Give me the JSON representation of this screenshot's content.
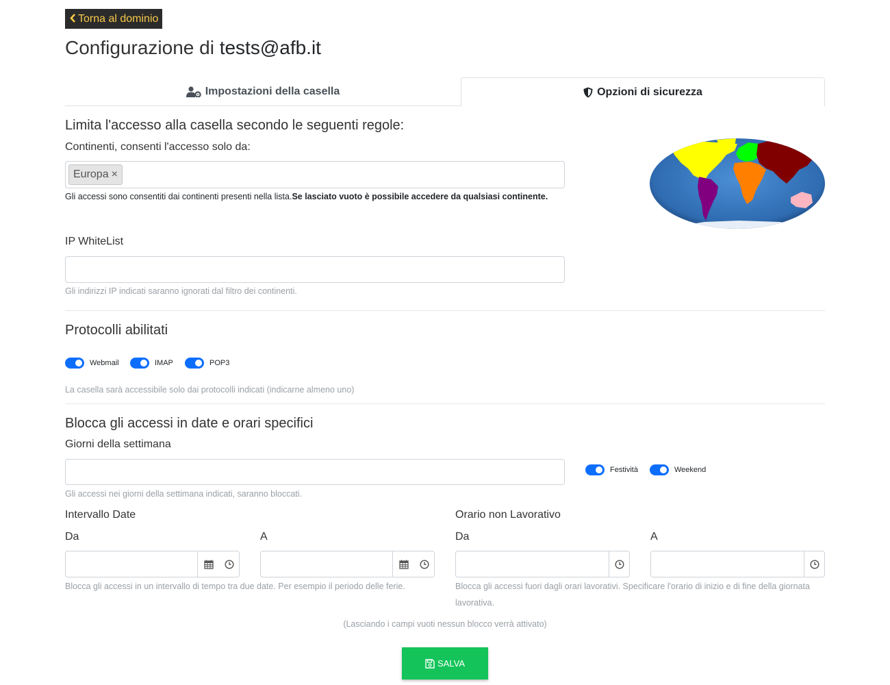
{
  "header": {
    "back_label": "Torna al dominio",
    "title_prefix": "Configurazione di ",
    "title_email": "tests@afb.it"
  },
  "tabs": [
    {
      "label": "Impostazioni della casella",
      "icon": "user-gear-icon",
      "active": false
    },
    {
      "label": "Opzioni di sicurezza",
      "icon": "shield-icon",
      "active": true
    }
  ],
  "access": {
    "heading": "Limita l'accesso alla casella secondo le seguenti regole:",
    "continents_label": "Continenti, consenti l'accesso solo da:",
    "selected_continents": [
      {
        "label": "Europa",
        "remove": "×"
      }
    ],
    "continents_help": "Gli accessi sono consentiti dai continenti presenti nella lista.",
    "continents_help_bold": "Se lasciato vuoto è possibile accedere da qualsiasi continente.",
    "map_colors": {
      "north_america": "#ffff00",
      "south_america": "#800080",
      "europe": "#00ff00",
      "africa": "#ff7f00",
      "asia": "#800000",
      "oceania": "#ffb6c1",
      "ocean": "#3d7bbf",
      "antarctica": "#e8eef7"
    },
    "whitelist_label": "IP WhiteList",
    "whitelist_value": "",
    "whitelist_help": "Gli indirizzi IP indicati saranno ignorati dal filtro dei continenti."
  },
  "protocols": {
    "heading": "Protocolli abilitati",
    "items": [
      {
        "label": "Webmail",
        "enabled": true
      },
      {
        "label": "IMAP",
        "enabled": true
      },
      {
        "label": "POP3",
        "enabled": true
      }
    ],
    "help": "La casella sarà accessibile solo dai protocolli indicati (indicarne almeno uno)"
  },
  "block": {
    "heading": "Blocca gli accessi in date e orari specifici",
    "weekdays_label": "Giorni della settimana",
    "weekdays_value": "",
    "weekdays_help": "Gli accessi nei giorni della settimana indicati, saranno bloccati.",
    "toggles": [
      {
        "label": "Festività",
        "enabled": true
      },
      {
        "label": "Weekend",
        "enabled": true
      }
    ],
    "date_range": {
      "label": "Intervallo Date",
      "from_label": "Da",
      "to_label": "A",
      "from_value": "",
      "to_value": "",
      "help": "Blocca gli accessi in un intervallo di tempo tra due date. Per esempio il periodo delle ferie."
    },
    "non_working": {
      "label": "Orario non Lavorativo",
      "from_label": "Da",
      "to_label": "A",
      "from_value": "",
      "to_value": "",
      "help_line1": "Blocca gli accessi fuori dagli orari lavorativi. Specificare l'orario di inizio e di fine della giornata",
      "help_line2": "lavorativa."
    },
    "empty_note": "(Lasciando i campi vuoti nessun blocco verrà attivato)"
  },
  "save": {
    "label": "SALVA",
    "icon": "floppy-disk-icon"
  },
  "colors": {
    "accent": "#0d6efd",
    "save": "#14c45a",
    "back_bg": "#2b2b2b",
    "back_text": "#f7c948"
  }
}
